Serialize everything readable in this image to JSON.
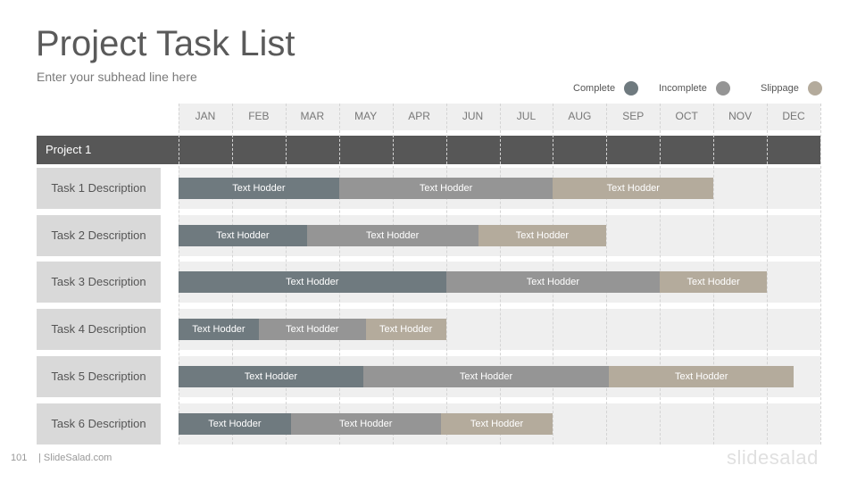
{
  "title": "Project Task List",
  "subhead": "Enter your subhead line here",
  "legend": {
    "complete": {
      "label": "Complete",
      "color": "#6f7a7f"
    },
    "incomplete": {
      "label": "Incomplete",
      "color": "#959595"
    },
    "slippage": {
      "label": "Slippage",
      "color": "#b4ab9c"
    }
  },
  "months": [
    "JAN",
    "FEB",
    "MAR",
    "MAY",
    "APR",
    "JUN",
    "JUL",
    "AUG",
    "SEP",
    "OCT",
    "NOV",
    "DEC"
  ],
  "project": {
    "label": "Project 1"
  },
  "tasks": [
    {
      "label": "Task 1 Description",
      "segments": [
        {
          "status": "complete",
          "months": 3,
          "label": "Text Hodder"
        },
        {
          "status": "incomplete",
          "months": 4,
          "label": "Text Hodder"
        },
        {
          "status": "slippage",
          "months": 3,
          "label": "Text Hodder"
        }
      ]
    },
    {
      "label": "Task 2 Description",
      "segments": [
        {
          "status": "complete",
          "months": 2.4,
          "label": "Text Hodder"
        },
        {
          "status": "incomplete",
          "months": 3.2,
          "label": "Text Hodder"
        },
        {
          "status": "slippage",
          "months": 2.4,
          "label": "Text Hodder"
        }
      ]
    },
    {
      "label": "Task 3 Description",
      "segments": [
        {
          "status": "complete",
          "months": 5,
          "label": "Text Hodder"
        },
        {
          "status": "incomplete",
          "months": 4,
          "label": "Text Hodder"
        },
        {
          "status": "slippage",
          "months": 2,
          "label": "Text Hodder"
        }
      ]
    },
    {
      "label": "Task 4 Description",
      "segments": [
        {
          "status": "complete",
          "months": 1.5,
          "label": "Text Hodder"
        },
        {
          "status": "incomplete",
          "months": 2,
          "label": "Text Hodder"
        },
        {
          "status": "slippage",
          "months": 1.5,
          "label": "Text Hodder"
        }
      ]
    },
    {
      "label": "Task 5 Description",
      "segments": [
        {
          "status": "complete",
          "months": 3.45,
          "label": "Text Hodder"
        },
        {
          "status": "incomplete",
          "months": 4.6,
          "label": "Text Hodder"
        },
        {
          "status": "slippage",
          "months": 3.45,
          "label": "Text Hodder"
        }
      ]
    },
    {
      "label": "Task 6 Description",
      "segments": [
        {
          "status": "complete",
          "months": 2.1,
          "label": "Text Hodder"
        },
        {
          "status": "incomplete",
          "months": 2.8,
          "label": "Text Hodder"
        },
        {
          "status": "slippage",
          "months": 2.1,
          "label": "Text Hodder"
        }
      ]
    }
  ],
  "footer": {
    "page_number": "101",
    "site": "| SlideSalad.com",
    "brand": "slidesalad"
  }
}
